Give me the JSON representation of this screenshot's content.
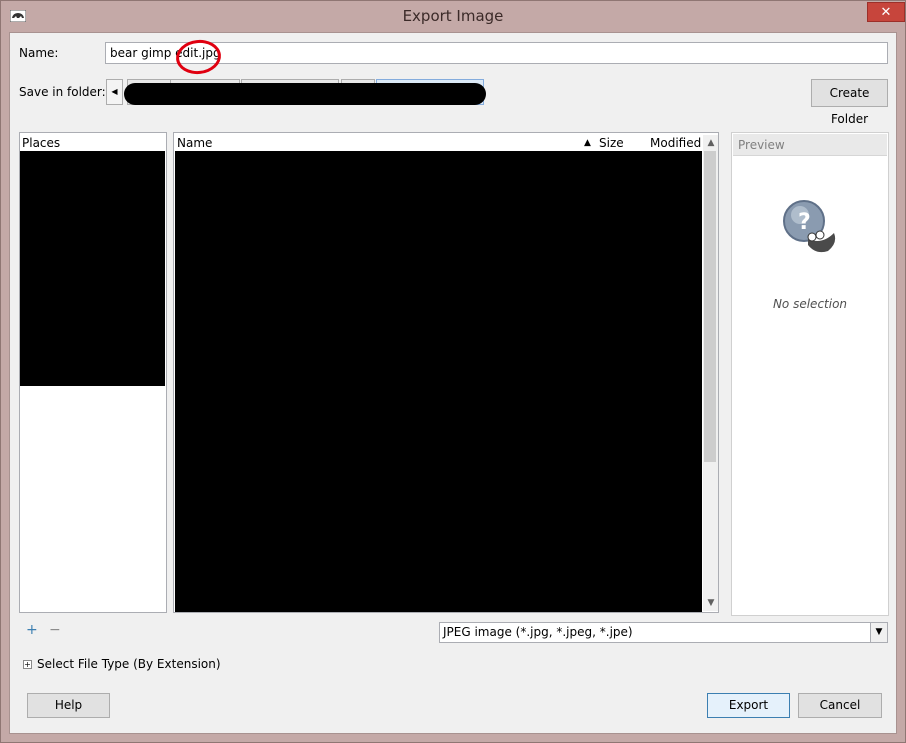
{
  "window": {
    "title": "Export Image",
    "close_glyph": "✕",
    "app_icon": "gimp-wilber-icon"
  },
  "form": {
    "name_label": "Name:",
    "name_value": "bear gimp edit.jpg",
    "save_in_label": "Save in folder:",
    "create_folder_label": "Create Folder"
  },
  "places": {
    "header": "Places"
  },
  "files": {
    "columns": {
      "name": "Name",
      "size": "Size",
      "modified": "Modified"
    },
    "sort_glyph": "▲"
  },
  "preview": {
    "header": "Preview",
    "no_selection": "No selection"
  },
  "filter": {
    "selected": "JPEG image (*.jpg, *.jpeg, *.jpe)"
  },
  "file_type_expander": {
    "label": "Select File Type (By Extension)"
  },
  "buttons": {
    "help": "Help",
    "export": "Export",
    "cancel": "Cancel",
    "add_place": "+",
    "remove_place": "−"
  },
  "colors": {
    "frame": "#c4a9a7",
    "close": "#c7453c",
    "annotation_circle": "#e00010",
    "accent": "#3c7fb1"
  }
}
